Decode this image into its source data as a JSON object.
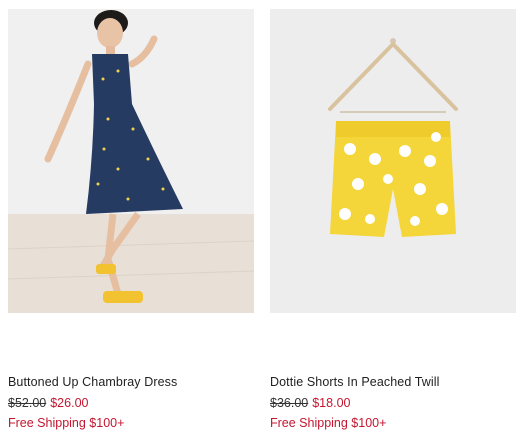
{
  "products": [
    {
      "name": "Buttoned Up Chambray Dress",
      "original_price": "$52.00",
      "sale_price": "$26.00",
      "shipping_note": "Free Shipping $100+",
      "image": "girl-in-chambray-dress"
    },
    {
      "name": "Dottie Shorts In Peached Twill",
      "original_price": "$36.00",
      "sale_price": "$18.00",
      "shipping_note": "Free Shipping $100+",
      "image": "yellow-polka-dot-shorts-on-hanger"
    }
  ],
  "colors": {
    "sale_red": "#c4162f",
    "dress_navy": "#24395e",
    "shorts_yellow": "#f4d53a",
    "floor_wood": "#e6ddd4",
    "wall": "#efefef"
  }
}
